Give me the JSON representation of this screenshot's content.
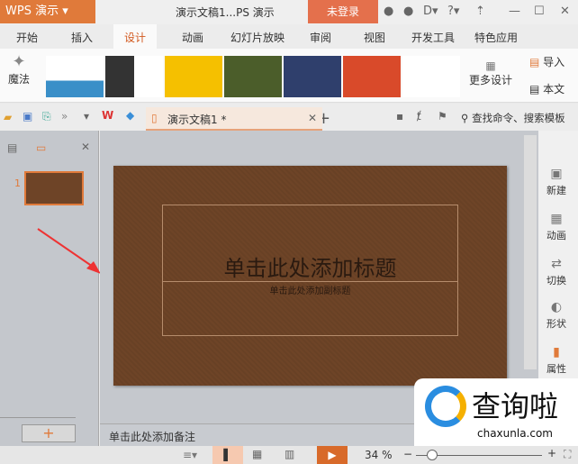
{
  "titlebar": {
    "app": "WPS 演示",
    "doc_title": "演示文稿1...PS 演示",
    "login": "未登录"
  },
  "tabs": [
    "开始",
    "插入",
    "设计",
    "动画",
    "幻灯片放映",
    "审阅",
    "视图",
    "开发工具",
    "特色应用"
  ],
  "active_tab": "设计",
  "ribbon": {
    "magic": "魔法",
    "more": "更多设计",
    "import": "导入",
    "text": "本文"
  },
  "qat": {
    "doc_tab": "演示文稿1 *",
    "search": "查找命令、搜索模板"
  },
  "slides_panel": {
    "slide_number": "1",
    "add": "+"
  },
  "slide": {
    "title": "单击此处添加标题",
    "subtitle": "单击此处添加副标题"
  },
  "notes": "单击此处添加备注",
  "right_sidebar": [
    "新建",
    "动画",
    "切换",
    "形状",
    "属性"
  ],
  "status": {
    "zoom": "34 %"
  },
  "watermark": {
    "name": "查询啦",
    "url": "chaxunla.com"
  },
  "colors": {
    "accent": "#e07a3a",
    "slide_bg": "#6e4427"
  }
}
